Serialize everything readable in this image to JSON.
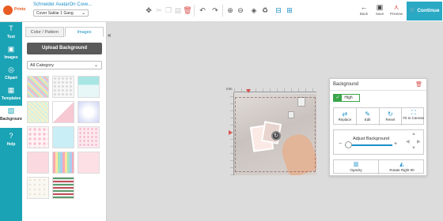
{
  "header": {
    "logo_text": "Printo",
    "product_title": "Schneider AvatarOn Cove...",
    "product_option": "Cover Saklar 1 Gang",
    "tools": [
      {
        "name": "move-icon",
        "glyph": "✥"
      },
      {
        "name": "cut-icon",
        "glyph": "✂"
      },
      {
        "name": "copy-icon",
        "glyph": "❐"
      },
      {
        "name": "paste-icon",
        "glyph": "▤"
      },
      {
        "name": "delete-icon",
        "glyph": "🗑"
      },
      {
        "name": "undo-icon",
        "glyph": "↶"
      },
      {
        "name": "redo-icon",
        "glyph": "↷"
      },
      {
        "name": "zoom-in-icon",
        "glyph": "⊕"
      },
      {
        "name": "zoom-out-icon",
        "glyph": "⊖"
      },
      {
        "name": "layers-icon",
        "glyph": "◈"
      },
      {
        "name": "recycle-icon",
        "glyph": "♻"
      },
      {
        "name": "align-icon",
        "glyph": "⊟"
      },
      {
        "name": "distribute-icon",
        "glyph": "⊞"
      }
    ],
    "back_label": "Back",
    "save_label": "Save",
    "preview_label": "Preview",
    "continue_label": "Continue"
  },
  "leftnav": {
    "items": [
      {
        "label": "Text",
        "glyph": "T"
      },
      {
        "label": "Images",
        "glyph": "▣"
      },
      {
        "label": "Clipart",
        "glyph": "◎"
      },
      {
        "label": "Templates",
        "glyph": "▦"
      },
      {
        "label": "Background",
        "glyph": "▧"
      },
      {
        "label": "Help",
        "glyph": "?"
      }
    ]
  },
  "panel": {
    "tab_color": "Color / Pattern",
    "tab_images": "Images",
    "upload_label": "Upload Background",
    "category_value": "All Category",
    "collapse_glyph": "«",
    "thumbnails": [
      "stripes-multi",
      "dots-grey",
      "teal-plain",
      "mint-stripes",
      "pink-triangle",
      "lilac-burst",
      "pink-floral",
      "sky-blue",
      "pink-dots",
      "pink-light",
      "rainbow-stripes",
      "rose-soft",
      "cream-plain",
      "green-stripes"
    ]
  },
  "canvas": {
    "unit_label": "mm"
  },
  "bgpanel": {
    "title": "Background",
    "high_label": "High",
    "actions": [
      {
        "label": "Replace",
        "glyph": "⇄"
      },
      {
        "label": "Edit",
        "glyph": "✎"
      },
      {
        "label": "Reset",
        "glyph": "↻"
      },
      {
        "label": "Fit to Canvas",
        "glyph": "⛶"
      }
    ],
    "adjust_label": "Adjust Background",
    "opacity_label": "Opacity",
    "rotate_label": "Rotate Right 90",
    "accent": "#1a8fc9",
    "brand": "#1aa3b5"
  }
}
